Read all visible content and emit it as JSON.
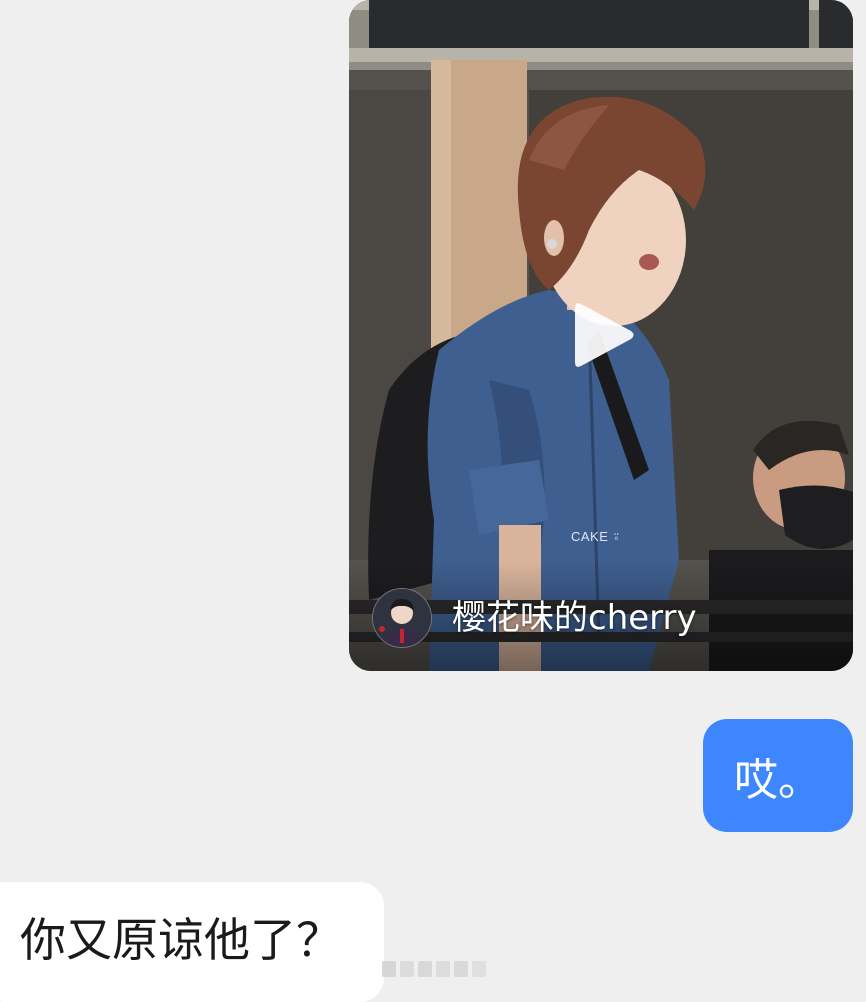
{
  "video_message": {
    "author_name": "樱花味的cherry",
    "watermark": "CAKE",
    "play_icon": "play-icon"
  },
  "messages": [
    {
      "direction": "outgoing",
      "text": "哎。"
    },
    {
      "direction": "incoming",
      "text": "你又原谅他了？"
    }
  ],
  "colors": {
    "background": "#efefef",
    "outgoing_bubble": "#3d86fd",
    "incoming_bubble": "#ffffff"
  }
}
